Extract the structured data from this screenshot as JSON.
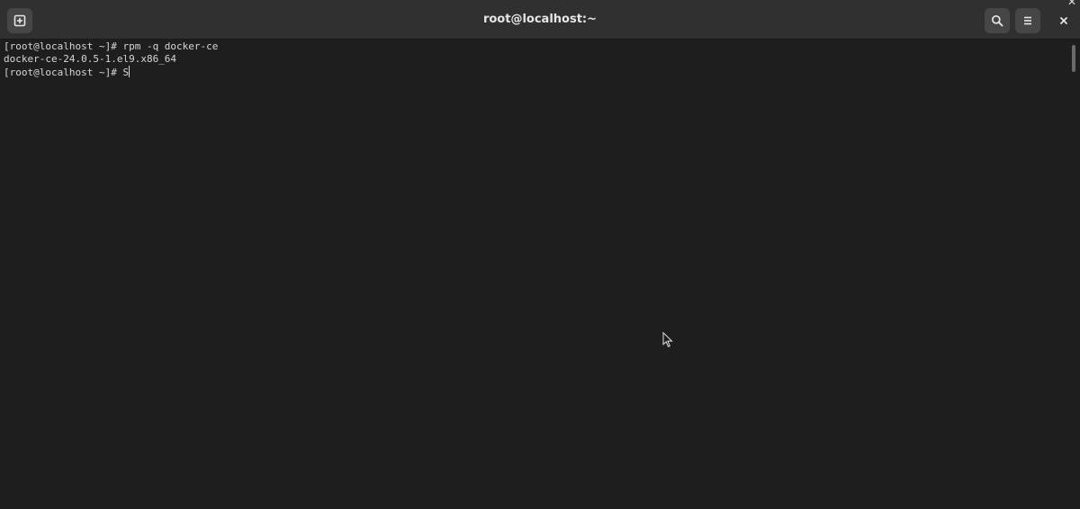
{
  "window": {
    "title": "root@localhost:~",
    "buttons": {
      "new_tab_icon": "new-tab-icon",
      "search_icon": "search-icon",
      "menu_icon": "hamburger-menu-icon",
      "close_icon": "close-icon"
    },
    "corner_close": "✕"
  },
  "terminal": {
    "lines": [
      "[root@localhost ~]# rpm -q docker-ce",
      "docker-ce-24.0.5-1.el9.x86_64",
      "[root@localhost ~]# S"
    ]
  },
  "colors": {
    "background": "#1e1e1e",
    "headerbar": "#303030",
    "button": "#464646",
    "text": "#d6d6d6"
  }
}
